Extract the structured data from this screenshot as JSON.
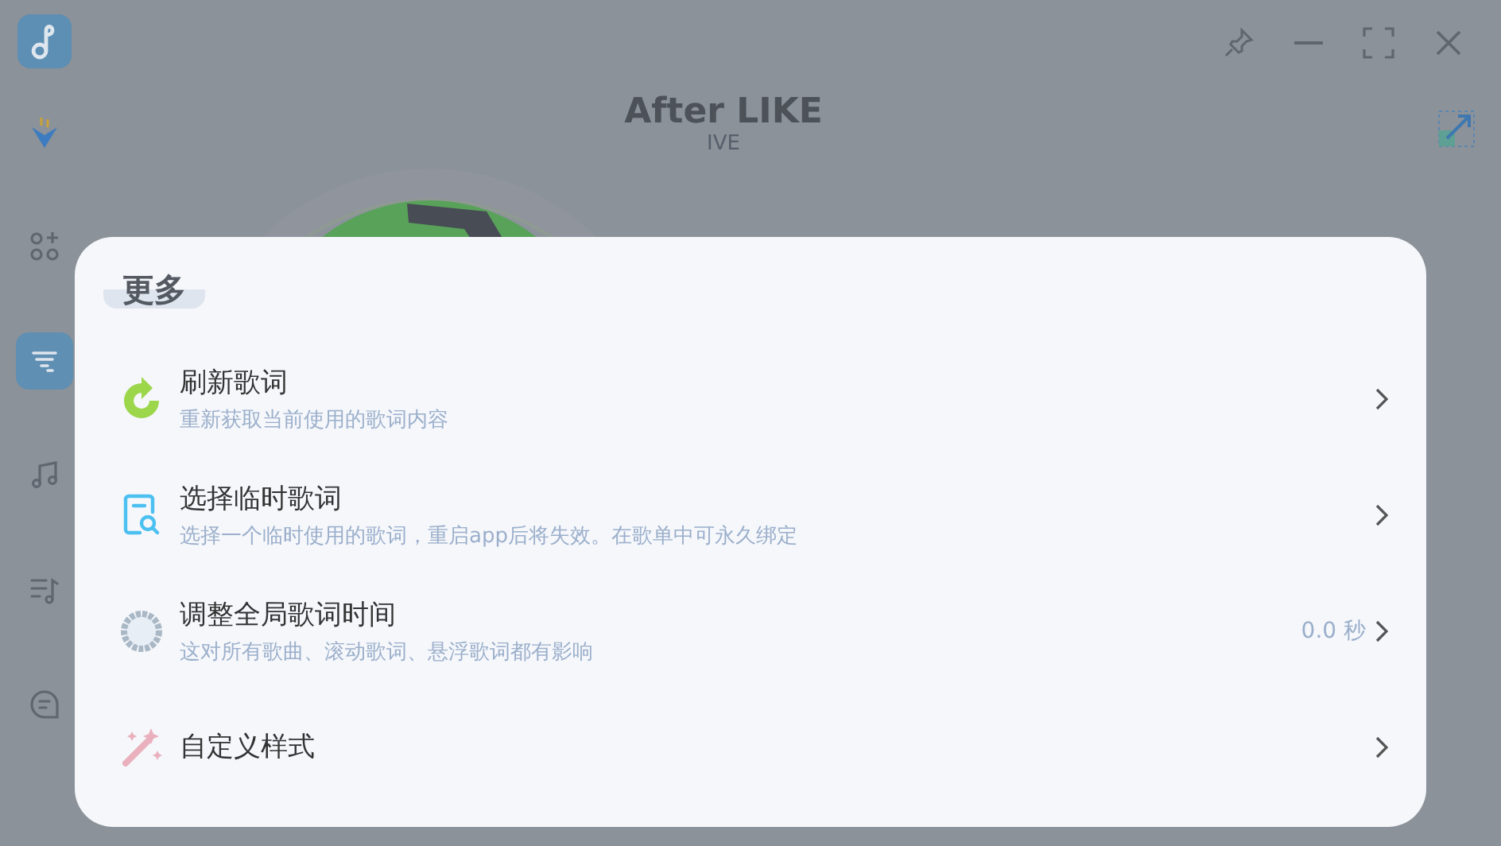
{
  "sidebar": {
    "items": [
      {
        "selected": false
      },
      {
        "selected": false
      },
      {
        "selected": true
      },
      {
        "selected": false
      },
      {
        "selected": false
      },
      {
        "selected": false
      }
    ]
  },
  "now_playing": {
    "title": "After LIKE",
    "artist": "IVE"
  },
  "dialog": {
    "title": "更多",
    "items": [
      {
        "title": "刷新歌词",
        "subtitle": "重新获取当前使用的歌词内容"
      },
      {
        "title": "选择临时歌词",
        "subtitle": "选择一个临时使用的歌词，重启app后将失效。在歌单中可永久绑定"
      },
      {
        "title": "调整全局歌词时间",
        "subtitle": "这对所有歌曲、滚动歌词、悬浮歌词都有影响",
        "value": "0.0 秒"
      },
      {
        "title": "自定义样式"
      }
    ]
  }
}
